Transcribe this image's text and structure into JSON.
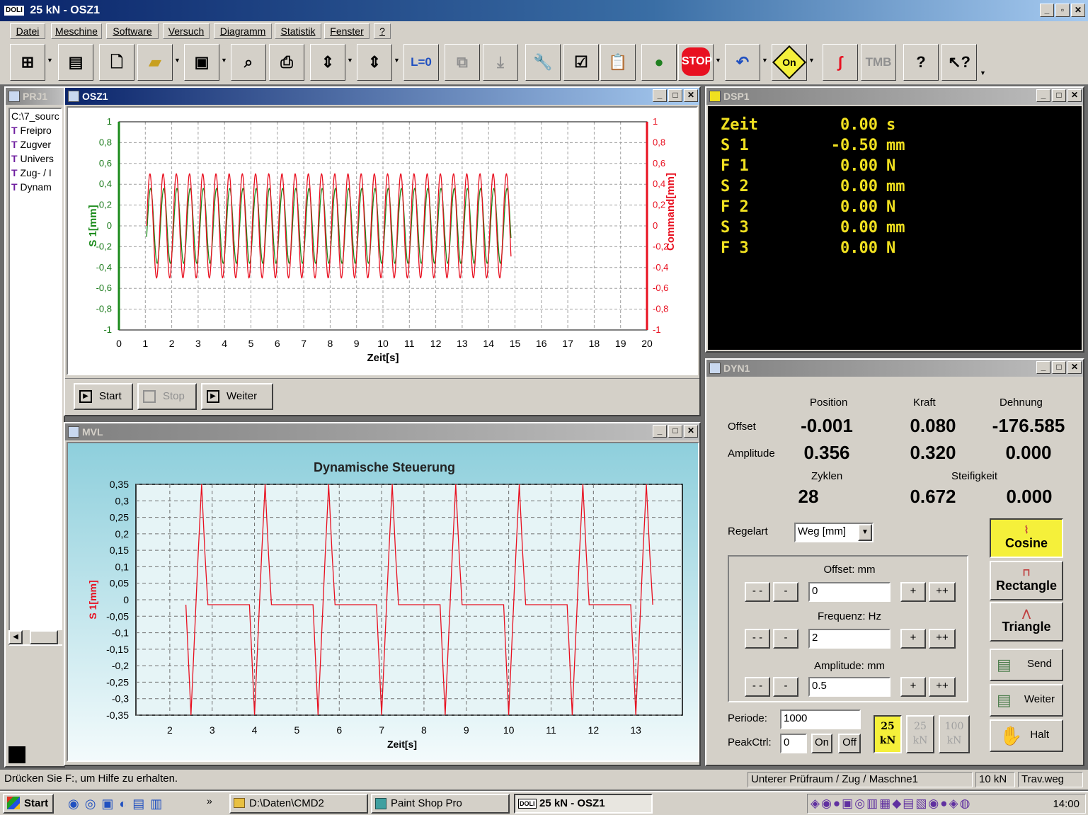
{
  "app": {
    "title": "25 kN - OSZ1",
    "logo": "DOLI"
  },
  "menu": [
    "Datei",
    "Meschine",
    "Software",
    "Versuch",
    "Diagramm",
    "Statistik",
    "Fenster",
    "?"
  ],
  "toolbar": {
    "l0": "L=0",
    "tmb": "TMB",
    "stop": "STOP",
    "on": "On"
  },
  "prj": {
    "title": "PRJ1",
    "path": "C:\\7_sourc",
    "items": [
      "Freipro",
      "Zugver",
      "Univers",
      "Zug- / I",
      "Dynam"
    ]
  },
  "osz": {
    "title": "OSZ1",
    "start": "Start",
    "stop": "Stop",
    "weiter": "Weiter",
    "xlabel": "Zeit[s]",
    "ylabel": "S 1[mm]",
    "y2label": "Command[mm]",
    "yticks": [
      "1",
      "0,8",
      "0,6",
      "0,4",
      "0,2",
      "0",
      "-0,2",
      "-0,4",
      "-0,6",
      "-0,8",
      "-1"
    ],
    "xticks": [
      "0",
      "1",
      "2",
      "3",
      "4",
      "5",
      "6",
      "7",
      "8",
      "9",
      "10",
      "11",
      "12",
      "13",
      "14",
      "15",
      "16",
      "17",
      "18",
      "19",
      "20"
    ]
  },
  "mvl": {
    "title": "MVL",
    "chart_title": "Dynamische Steuerung",
    "xlabel": "Zeit[s]",
    "ylabel": "S 1[mm]",
    "yticks": [
      "0,35",
      "0,3",
      "0,25",
      "0,2",
      "0,15",
      "0,1",
      "0,05",
      "0",
      "-0,05",
      "-0,1",
      "-0,15",
      "-0,2",
      "-0,25",
      "-0,3",
      "-0,35"
    ],
    "xticks": [
      "2",
      "3",
      "4",
      "5",
      "6",
      "7",
      "8",
      "9",
      "10",
      "11",
      "12",
      "13"
    ]
  },
  "chart_data": [
    {
      "type": "line",
      "title": "",
      "xlabel": "Zeit[s]",
      "ylabel": "S 1[mm]",
      "y2label": "Command[mm]",
      "xlim": [
        0,
        20
      ],
      "ylim": [
        -1,
        1
      ],
      "grid": true,
      "series": [
        {
          "name": "S 1[mm]",
          "color": "#1a8a1a",
          "x_start": 1.05,
          "x_end": 14.85,
          "amplitude": 0.36,
          "frequency_hz": 2
        },
        {
          "name": "Command[mm]",
          "color": "#e81020",
          "x_start": 1.05,
          "x_end": 14.85,
          "amplitude": 0.5,
          "frequency_hz": 2
        }
      ]
    },
    {
      "type": "line",
      "title": "Dynamische Steuerung",
      "xlabel": "Zeit[s]",
      "ylabel": "S 1[mm]",
      "xlim": [
        1.2,
        14.1
      ],
      "ylim": [
        -0.35,
        0.35
      ],
      "grid": true,
      "series": [
        {
          "name": "S 1[mm]",
          "color": "#e81020",
          "peaks_x": [
            2.75,
            4.25,
            5.75,
            7.25,
            8.75,
            10.25,
            11.75,
            13.25
          ],
          "peak": 0.35,
          "trough": -0.35,
          "plateau": -0.015
        }
      ]
    }
  ],
  "dsp": {
    "title": "DSP1",
    "rows": [
      {
        "name": "Zeit",
        "value": "0.00",
        "unit": "s"
      },
      {
        "name": "S 1",
        "value": "-0.50",
        "unit": "mm"
      },
      {
        "name": "F 1",
        "value": "0.00",
        "unit": "N"
      },
      {
        "name": "S 2",
        "value": "0.00",
        "unit": "mm"
      },
      {
        "name": "F 2",
        "value": "0.00",
        "unit": "N"
      },
      {
        "name": "S 3",
        "value": "0.00",
        "unit": "mm"
      },
      {
        "name": "F 3",
        "value": "0.00",
        "unit": "N"
      }
    ]
  },
  "dyn": {
    "title": "DYN1",
    "col_position": "Position",
    "col_kraft": "Kraft",
    "col_dehnung": "Dehnung",
    "offset_label": "Offset",
    "amplitude_label": "Amplitude",
    "offset_position": "-0.001",
    "offset_kraft": "0.080",
    "offset_dehnung": "-176.585",
    "amp_position": "0.356",
    "amp_kraft": "0.320",
    "amp_dehnung": "0.000",
    "zyklen_label": "Zyklen",
    "steifigkeit_label": "Steifigkeit",
    "zyklen": "28",
    "steif1": "0.672",
    "steif2": "0.000",
    "regelart_label": "Regelart",
    "regelart": "Weg [mm]",
    "offset_title": "Offset: mm",
    "offset_value": "0",
    "freq_title": "Frequenz: Hz",
    "freq_value": "2",
    "amp_title": "Amplitude: mm",
    "amp_value": "0.5",
    "minusminus": "- -",
    "minus": "-",
    "plus": "+",
    "plusplus": "++",
    "periode_label": "Periode:",
    "periode": "1000",
    "peak_label": "PeakCtrl:",
    "peak": "0",
    "on": "On",
    "off": "Off",
    "kn25a": "25",
    "kn25b": "25",
    "kn100": "100",
    "kn": "kN",
    "cosine": "Cosine",
    "rectangle": "Rectangle",
    "triangle": "Triangle",
    "send": "Send",
    "weiter": "Weiter",
    "halt": "Halt"
  },
  "status": {
    "help": "Drücken Sie F:, um Hilfe zu erhalten.",
    "room": "Unterer Prüfraum / Zug / Maschne1",
    "load": "10 kN",
    "trav": "Trav.weg"
  },
  "taskbar": {
    "start": "Start",
    "more": "»",
    "task1": "D:\\Daten\\CMD2",
    "task2": "Paint Shop Pro",
    "task3": "25 kN - OSZ1",
    "logo": "DOLI",
    "time": "14:00"
  },
  "colors": {
    "accent": "#0a246a",
    "dsp_bg": "#000000",
    "dsp_text": "#f0e020",
    "cosine_active": "#f5f03a",
    "s1": "#1a8a1a",
    "command": "#e81020"
  }
}
